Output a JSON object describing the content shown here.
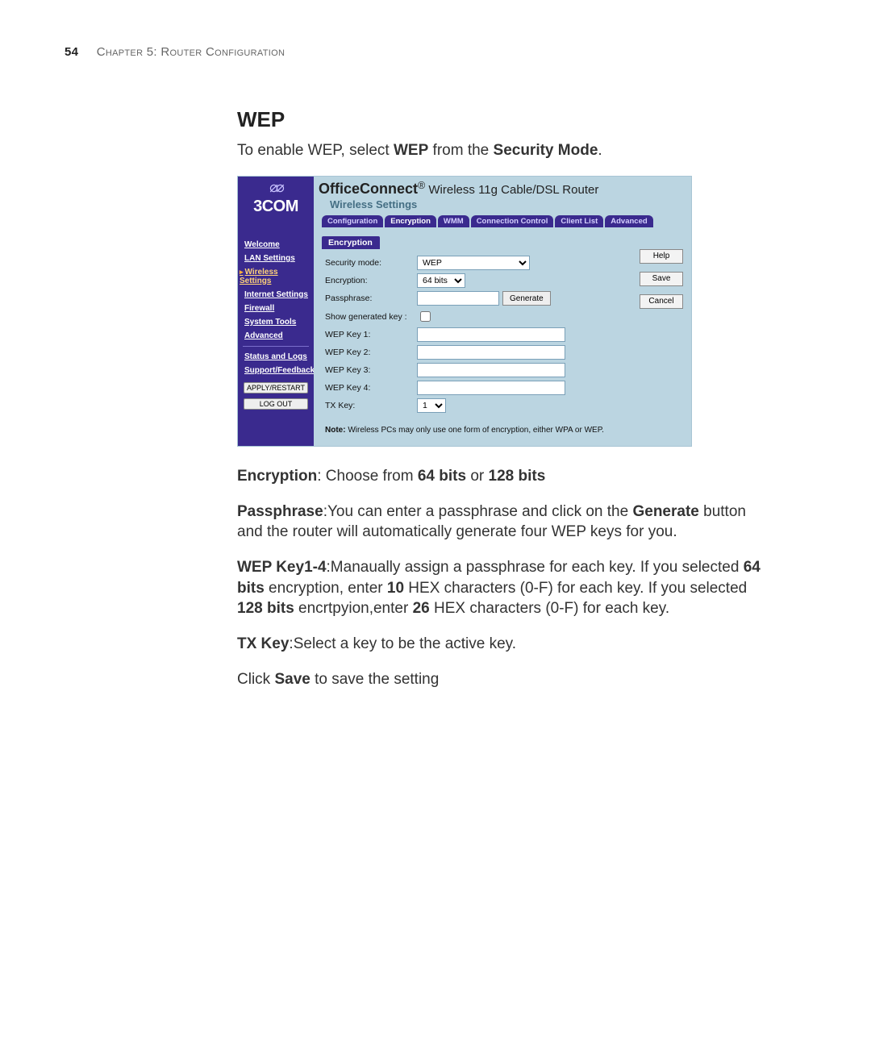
{
  "header": {
    "page_number": "54",
    "chapter_label": "Chapter 5: Router Configuration"
  },
  "section_title": "WEP",
  "intro": {
    "pre": "To enable WEP, select ",
    "bold1": "WEP",
    "mid": " from the ",
    "bold2": "Security Mode",
    "post": "."
  },
  "screenshot": {
    "logo_brand": "3COM",
    "banner_brand": "OfficeConnect",
    "banner_trademark": "®",
    "banner_product": " Wireless 11g Cable/DSL Router",
    "banner_sub": "Wireless Settings",
    "tabs": [
      "Configuration",
      "Encryption",
      "WMM",
      "Connection Control",
      "Client List",
      "Advanced"
    ],
    "active_tab_index": 1,
    "nav": {
      "items_top": [
        "Welcome",
        "LAN Settings",
        "Wireless Settings",
        "Internet Settings",
        "Firewall",
        "System Tools",
        "Advanced"
      ],
      "active_index": 2,
      "items_bottom": [
        "Status and Logs",
        "Support/Feedback"
      ],
      "btn_apply": "APPLY/RESTART",
      "btn_logout": "LOG OUT"
    },
    "panel": {
      "title": "Encryption",
      "labels": {
        "security_mode": "Security mode:",
        "encryption": "Encryption:",
        "passphrase": "Passphrase:",
        "show_key": "Show generated key :",
        "wep1": "WEP Key 1:",
        "wep2": "WEP Key 2:",
        "wep3": "WEP Key 3:",
        "wep4": "WEP Key 4:",
        "txkey": "TX Key:"
      },
      "values": {
        "security_mode": "WEP",
        "encryption": "64 bits",
        "txkey": "1",
        "generate": "Generate"
      },
      "note_label": "Note:",
      "note_text": " Wireless PCs may only use one form of encryption, either WPA or WEP.",
      "side_buttons": [
        "Help",
        "Save",
        "Cancel"
      ]
    }
  },
  "body_paragraphs": {
    "encryption": {
      "b1": "Encryption",
      "t1": ": Choose from ",
      "b2": "64 bits",
      "t2": " or ",
      "b3": "128 bits"
    },
    "passphrase": {
      "b1": "Passphrase",
      "t1": ":You can enter a passphrase and click on the ",
      "b2": "Generate",
      "t2": " button and the router will automatically generate four WEP keys for you."
    },
    "wepkeys": {
      "b1": "WEP Key1-4",
      "t1": ":Manaually assign a passphrase for each key. If you selected ",
      "b2": "64 bits",
      "t2": " encryption, enter ",
      "b3": "10",
      "t3": " HEX characters (0-F) for each key. If you selected ",
      "b4": "128 bits",
      "t4": " encrtpyion,enter ",
      "b5": "26",
      "t5": " HEX characters (0-F) for each key."
    },
    "txkey": {
      "b1": "TX Key",
      "t1": ":Select a key to be the active key."
    },
    "save": {
      "t1": "Click ",
      "b1": "Save",
      "t2": " to save the setting"
    }
  }
}
